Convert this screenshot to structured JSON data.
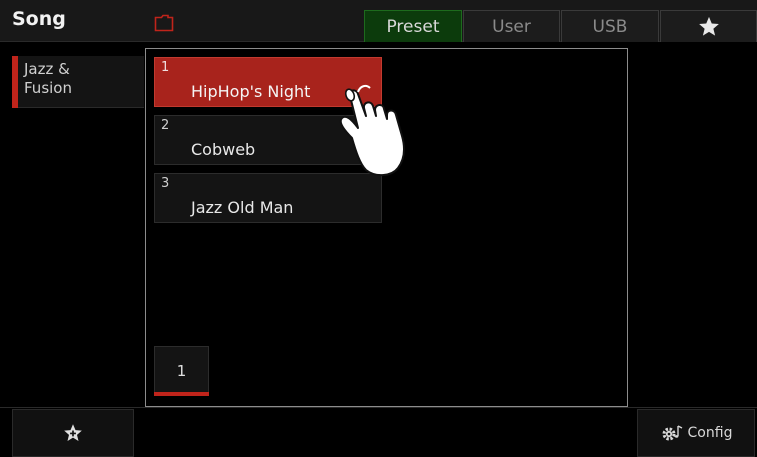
{
  "header": {
    "title": "Song",
    "tabs": [
      {
        "label": "Preset",
        "active": true
      },
      {
        "label": "User",
        "active": false
      },
      {
        "label": "USB",
        "active": false
      },
      {
        "label": "",
        "icon": "star-icon",
        "active": false
      }
    ],
    "folder_icon": "folder-icon"
  },
  "sidebar": {
    "items": [
      {
        "label": "Jazz &\nFusion",
        "selected": true
      }
    ]
  },
  "songs": [
    {
      "number": "1",
      "name": "HipHop's Night",
      "selected": true
    },
    {
      "number": "2",
      "name": "Cobweb",
      "selected": false
    },
    {
      "number": "3",
      "name": "Jazz Old Man",
      "selected": false
    }
  ],
  "pagination": {
    "current_page": "1"
  },
  "footer": {
    "favorite_icon": "add-favorite-star-icon",
    "config_label": "Config",
    "config_icon": "gear-music-icon"
  },
  "colors": {
    "accent_red": "#a8231c",
    "active_tab_green": "#0c3b0c",
    "folder_red": "#c0241b"
  }
}
